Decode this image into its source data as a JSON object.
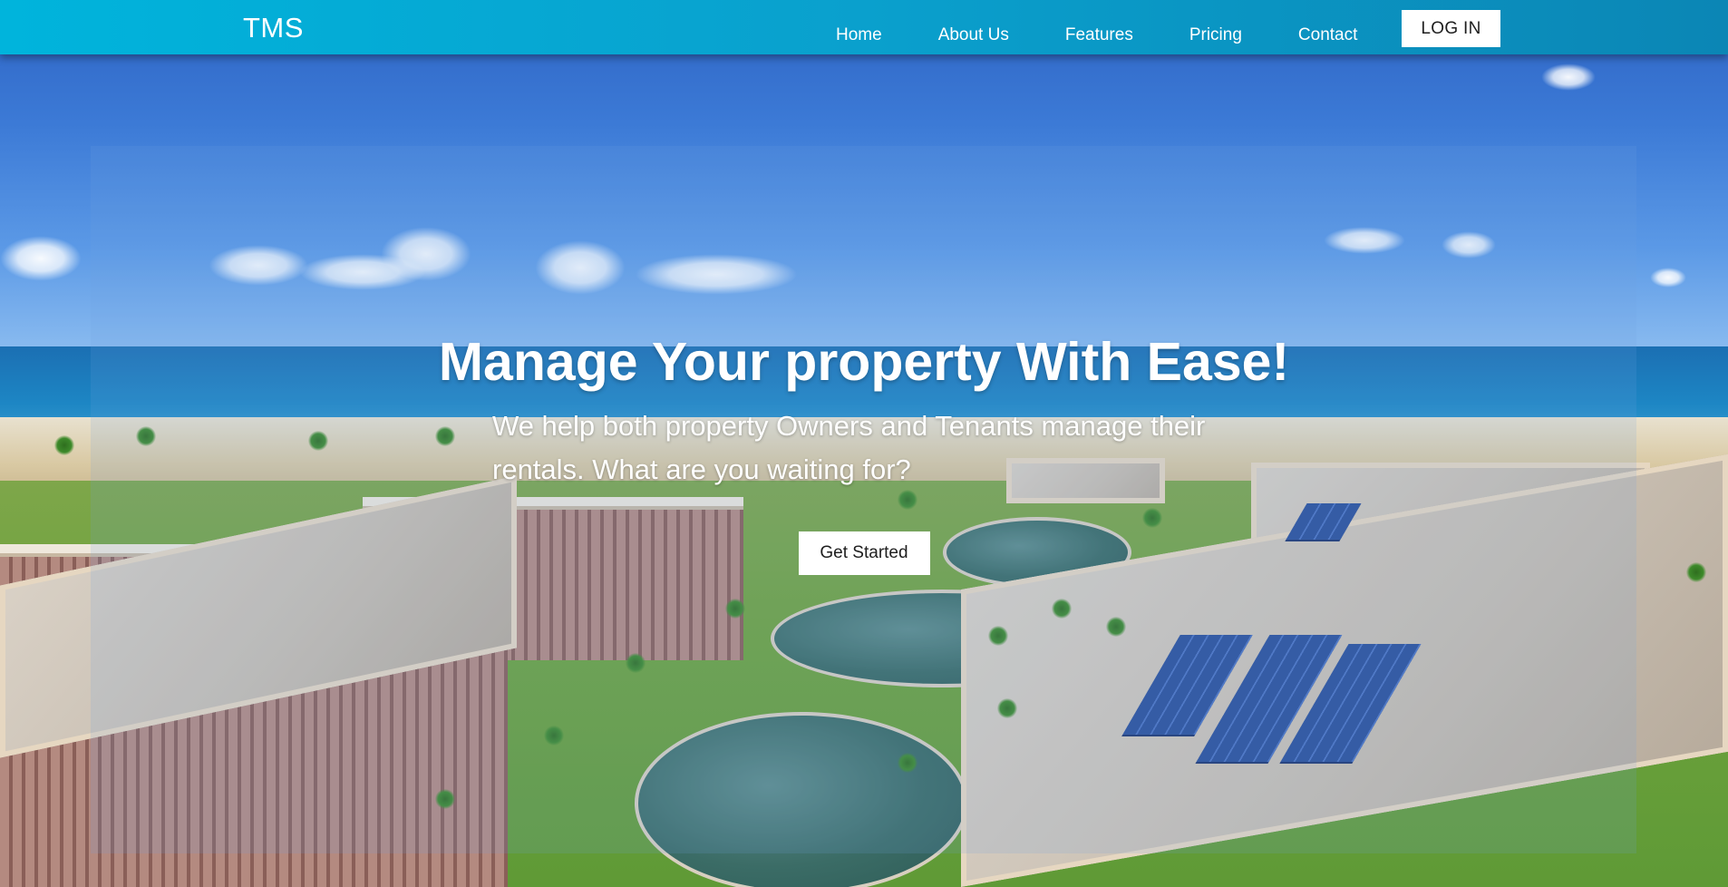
{
  "navbar": {
    "brand": "TMS",
    "links": [
      {
        "label": "Home"
      },
      {
        "label": "About Us"
      },
      {
        "label": "Features"
      },
      {
        "label": "Pricing"
      },
      {
        "label": "Contact"
      }
    ],
    "login_label": "LOG IN"
  },
  "hero": {
    "title": "Manage Your property With Ease!",
    "subtitle": "We help both property Owners and Tenants manage their rentals. What are you waiting for?",
    "cta_label": "Get Started"
  },
  "colors": {
    "navbar_start": "#00b4dc",
    "navbar_end": "#0b86b5",
    "button_bg": "#ffffff",
    "text_light": "#ffffff"
  }
}
